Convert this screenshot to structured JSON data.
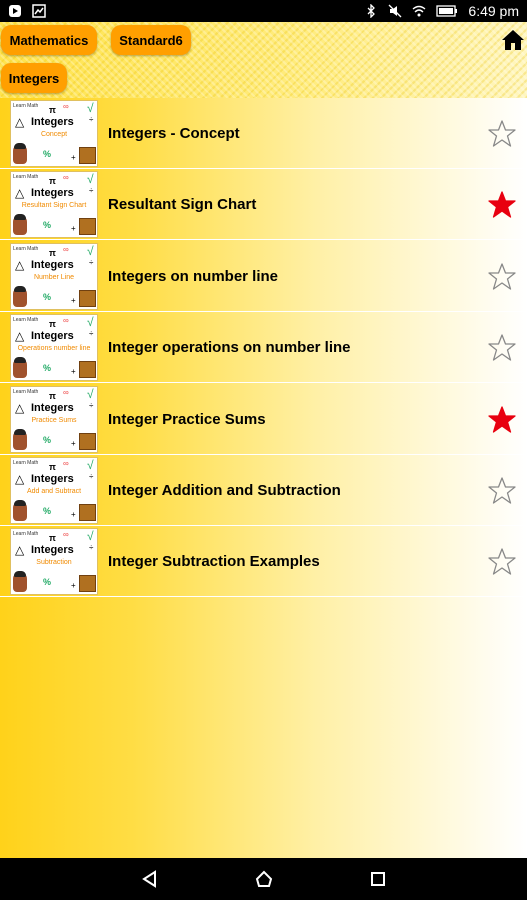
{
  "status_bar": {
    "time": "6:49 pm",
    "icons": [
      "app-notification-icon",
      "image-notification-icon",
      "bluetooth-icon",
      "mute-icon",
      "wifi-icon",
      "battery-icon"
    ]
  },
  "header": {
    "breadcrumbs": [
      "Mathematics",
      "Standard6"
    ],
    "current_topic": "Integers",
    "home_icon": "home-icon"
  },
  "list": {
    "thumb_title": "Integers",
    "thumb_tag": "Learn Math",
    "items": [
      {
        "label": "Integers - Concept",
        "thumb_sub": "Concept",
        "favorite": false
      },
      {
        "label": "Resultant Sign Chart",
        "thumb_sub": "Resultant Sign Chart",
        "favorite": true
      },
      {
        "label": "Integers on number line",
        "thumb_sub": "Number Line",
        "favorite": false
      },
      {
        "label": "Integer operations on number line",
        "thumb_sub": "Operations number line",
        "favorite": false
      },
      {
        "label": "Integer Practice Sums",
        "thumb_sub": "Practice Sums",
        "favorite": true
      },
      {
        "label": "Integer Addition and Subtraction",
        "thumb_sub": "Add and Subtract",
        "favorite": false
      },
      {
        "label": "Integer Subtraction Examples",
        "thumb_sub": "Subtraction",
        "favorite": false
      }
    ]
  },
  "nav_bar": {
    "icons": [
      "back-icon",
      "home-nav-icon",
      "recents-icon"
    ]
  },
  "colors": {
    "chip": "#ff9f00",
    "favorite_star": "#e8000f",
    "empty_star": "#888888"
  }
}
